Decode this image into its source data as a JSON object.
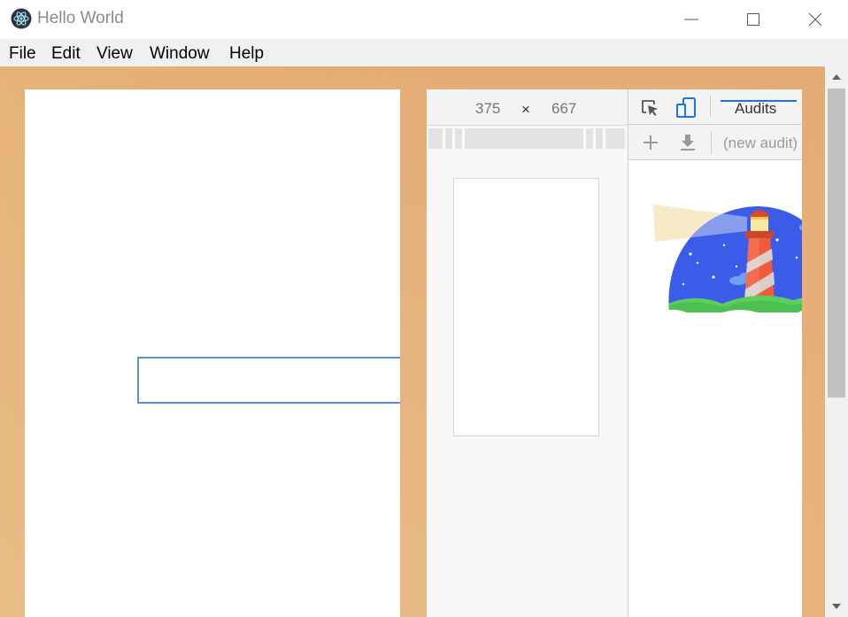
{
  "window": {
    "title": "Hello World",
    "icon": "electron-icon",
    "controls": [
      "minimize-icon",
      "maximize-icon",
      "close-icon"
    ]
  },
  "menu": {
    "items": [
      "File",
      "Edit",
      "View",
      "Window",
      "Help"
    ]
  },
  "page": {
    "input_value": "",
    "background_colors": [
      "#e2a86e",
      "#e7c08a"
    ]
  },
  "devtools": {
    "device_toolbar": {
      "width": "375",
      "separator": "×",
      "height": "667",
      "more": "⋮"
    },
    "tabs": [
      "Audits"
    ],
    "active_tab": "Audits",
    "accent_color": "#1a73e8",
    "audits_toolbar": {
      "add_icon": "plus-icon",
      "download_icon": "download-icon",
      "selected_report": "(new audit)"
    },
    "illustration": "lighthouse-logo"
  },
  "scrollbar": {
    "up_icon": "arrow-up-icon",
    "down_icon": "arrow-down-icon"
  }
}
